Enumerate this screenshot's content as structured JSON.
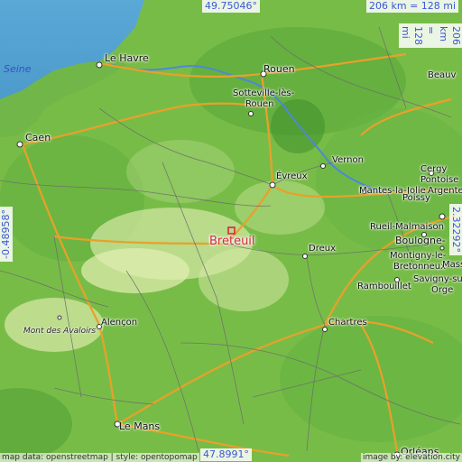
{
  "map": {
    "focus_city": "Breteuil",
    "coords": {
      "top": "49.75046°",
      "bottom": "47.8991°",
      "left": "-0.48958°",
      "right": "2.32292°"
    },
    "scale": {
      "horizontal": "206 km = 128 mi",
      "vertical": "206 km = 128 mi"
    },
    "sea_label": "Seine",
    "relief_label": "Mont des Avaloirs",
    "attribution_left": "map data: openstreetmap | style: opentopomap",
    "attribution_right": "image by: elevation.city",
    "cities": {
      "le_havre": "Le Havre",
      "rouen": "Rouen",
      "sotteville": "Sotteville-lès-",
      "sotteville2": "Rouen",
      "caen": "Caen",
      "evreux": "Évreux",
      "vernon": "Vernon",
      "mantes": "Mantes-la-Jolie",
      "poissy": "Poissy",
      "cergy": "Cergy",
      "pontoise": "Pontoise",
      "argenteuil": "Argente",
      "beauvais": "Beauv",
      "rueil": "Rueil-Malmaison",
      "boulogne": "Boulogne-",
      "montigny1": "Montigny-le-",
      "montigny2": "Bretonneux",
      "massy": "Massy",
      "savigny": "Savigny-sur",
      "orge": "Orge",
      "dreux": "Dreux",
      "rambouillet": "Rambouillet",
      "chartres": "Chartres",
      "alencon": "Alençon",
      "le_mans": "Le Mans",
      "orleans": "Orléans"
    },
    "colors": {
      "sea": "#5aa8d6",
      "land": "#7bbf4a",
      "highland": "#cfe6a0",
      "road_major": "#e8a12a",
      "road_minor": "#666666",
      "focus_marker": "#d6283a",
      "coord_text": "#3b57d6"
    }
  }
}
